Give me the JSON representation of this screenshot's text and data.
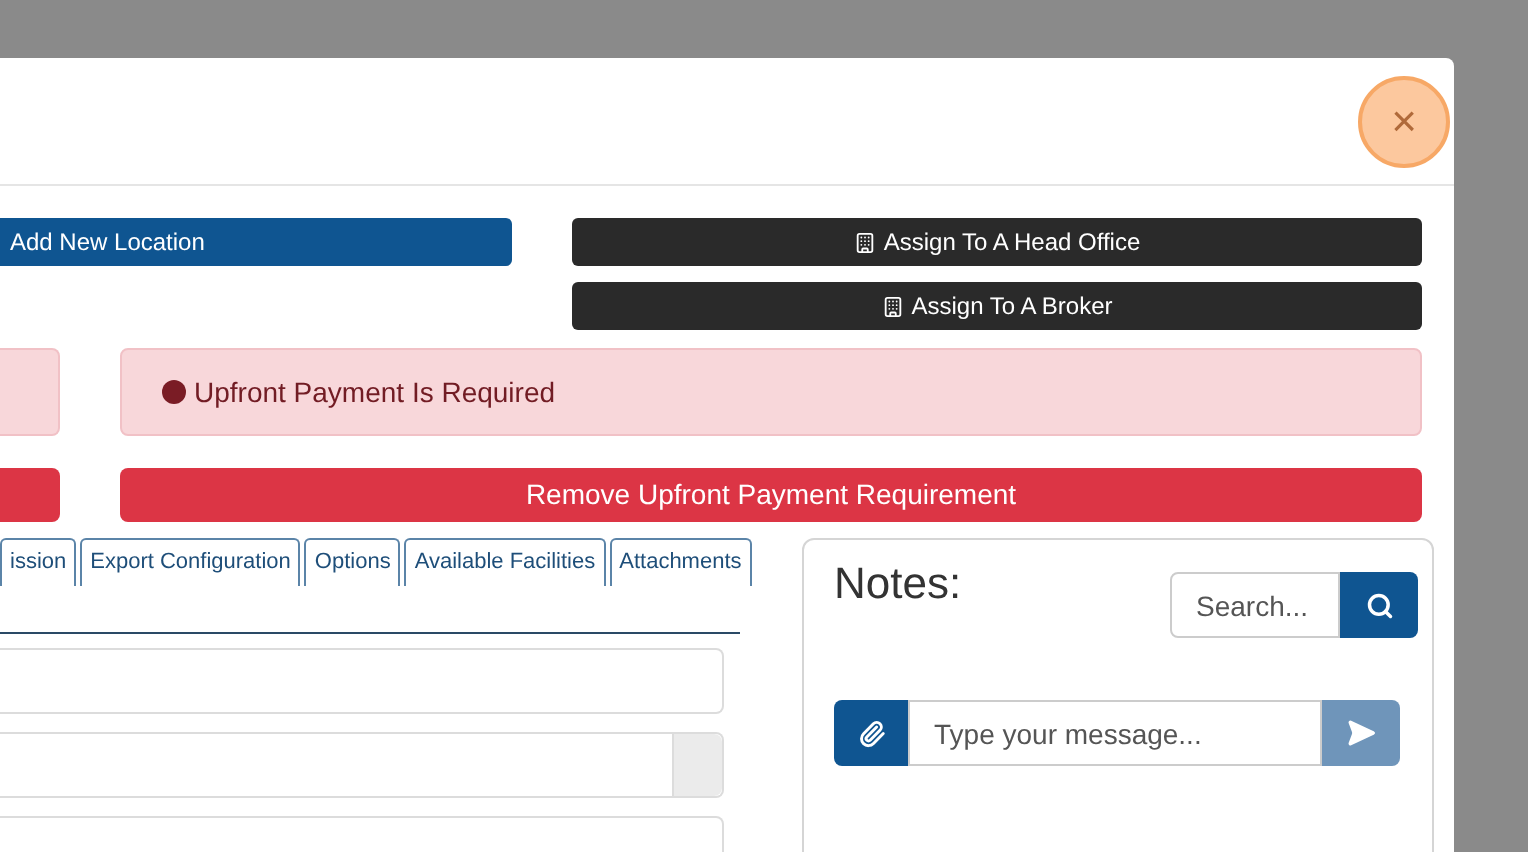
{
  "modal": {
    "close_label": "×"
  },
  "location_button": {
    "label": "Add New Location"
  },
  "assign_buttons": [
    {
      "label": "Assign To A Head Office"
    },
    {
      "label": "Assign To A Broker"
    }
  ],
  "alert": {
    "text": "Upfront Payment Is Required"
  },
  "remove_button": {
    "label": "Remove Upfront Payment Requirement"
  },
  "tabs": [
    {
      "label": "ission",
      "selected": false
    },
    {
      "label": "Export Configuration",
      "selected": false
    },
    {
      "label": "Options",
      "selected": false
    },
    {
      "label": "Available Facilities",
      "selected": false
    },
    {
      "label": "Attachments",
      "selected": false
    }
  ],
  "notes": {
    "title": "Notes:",
    "search": {
      "placeholder": "Search..."
    },
    "message": {
      "placeholder": "Type your message..."
    }
  }
}
